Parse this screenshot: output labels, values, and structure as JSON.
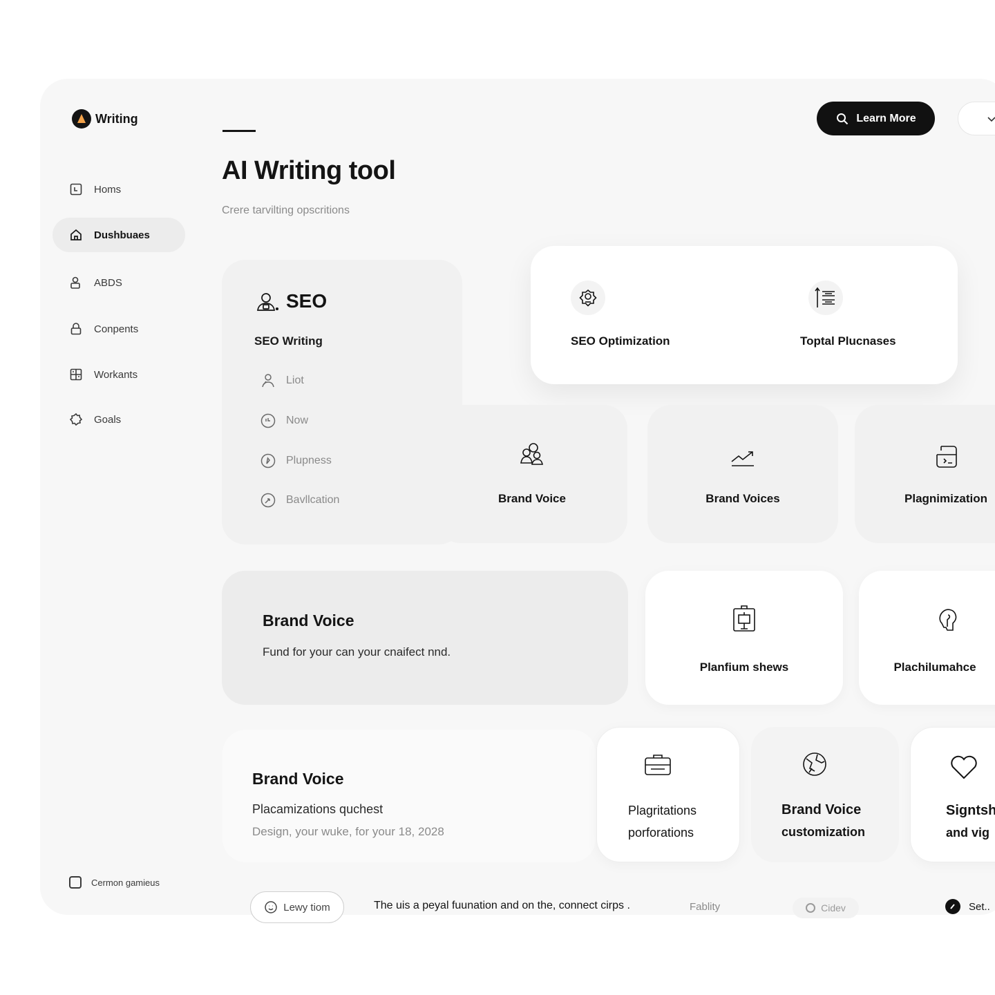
{
  "app": {
    "brand": "Writing"
  },
  "header": {
    "learn_more": "Learn More"
  },
  "page": {
    "title": "AI Writing tool",
    "subtitle": "Crere tarvilting opscritions"
  },
  "sidebar": {
    "items": [
      {
        "label": "Homs",
        "icon": "inbox-icon"
      },
      {
        "label": "Dushbuaes",
        "icon": "home-icon",
        "active": true
      },
      {
        "label": "ABDS",
        "icon": "user-lock-icon"
      },
      {
        "label": "Conpents",
        "icon": "lock-icon"
      },
      {
        "label": "Workants",
        "icon": "grid-doc-icon"
      },
      {
        "label": "Goals",
        "icon": "gear-icon"
      }
    ],
    "footer_label": "Cermon gamieus"
  },
  "seo_card": {
    "title": "SEO",
    "subtitle": "SEO Writing",
    "items": [
      {
        "label": "Liot",
        "icon": "person-icon"
      },
      {
        "label": "Now",
        "icon": "clock-icon"
      },
      {
        "label": "Plupness",
        "icon": "compass-icon"
      },
      {
        "label": "Bavllcation",
        "icon": "timer-icon"
      }
    ]
  },
  "feature_card": {
    "items": [
      {
        "label": "SEO Optimization",
        "icon": "badge-gear-icon"
      },
      {
        "label": "Toptal Plucnases",
        "icon": "list-icon"
      }
    ]
  },
  "tiles_row1": [
    {
      "label": "Brand Voice",
      "icon": "people-icon"
    },
    {
      "label": "Brand Voices",
      "icon": "trend-icon"
    },
    {
      "label": "Plagnimization",
      "icon": "terminal-icon"
    }
  ],
  "brand_voice_wide": {
    "title": "Brand Voice",
    "description": "Fund for your can your cnaifect nnd."
  },
  "tiles_row2": [
    {
      "label": "Planfium shews",
      "icon": "board-icon"
    },
    {
      "label": "Plachilumahce",
      "icon": "head-icon"
    }
  ],
  "brand_voice_bottom": {
    "title": "Brand Voice",
    "subtitle": "Placamizations quchest",
    "meta": "Design, your wuke, for your 18, 2028"
  },
  "tiles_row3": [
    {
      "line1": "Plagritations",
      "line2": "porforations",
      "icon": "briefcase-icon"
    },
    {
      "line1": "Brand Voice",
      "line2": "customization",
      "icon": "globe-icon"
    },
    {
      "line1": "Signtsh",
      "line2": "and vig",
      "icon": "heart-icon"
    }
  ],
  "bottom_bar": {
    "chip": "Lewy tiom",
    "text": "The uis a peyal fuunation and on the, connect cirps .",
    "fablity": "Fablity",
    "pill": "Cidev",
    "set": "Set.."
  }
}
